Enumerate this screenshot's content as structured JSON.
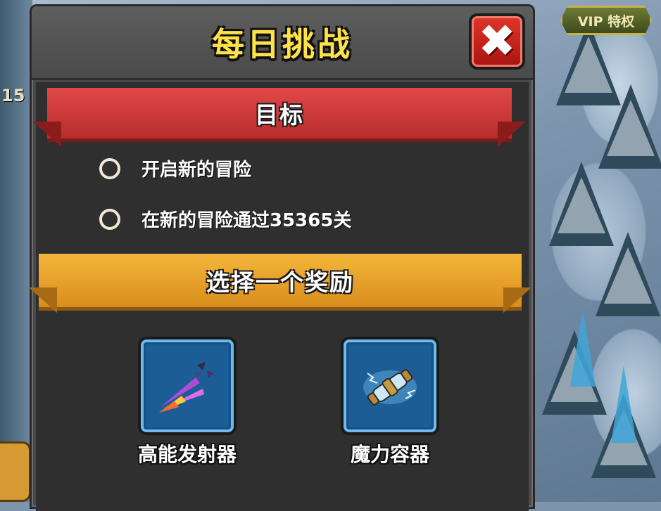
{
  "dialog": {
    "title": "每日挑战",
    "close_label": "✖"
  },
  "objectives": {
    "header": "目标",
    "items": [
      {
        "label": "开启新的冒险",
        "completed": false
      },
      {
        "label": "在新的冒险通过35365关",
        "completed": false
      }
    ]
  },
  "rewards": {
    "header": "选择一个奖励",
    "items": [
      {
        "label": "高能发射器",
        "icon": "rocket-launcher-icon"
      },
      {
        "label": "魔力容器",
        "icon": "magic-container-icon"
      }
    ]
  },
  "background": {
    "vip_label": "VIP 特权",
    "edge_text": "15"
  },
  "colors": {
    "title": "#ffe14a",
    "objective_ribbon": "#e24848",
    "reward_ribbon": "#f4b63b",
    "close_button": "#e0372c",
    "reward_card": "#1c5d96"
  }
}
